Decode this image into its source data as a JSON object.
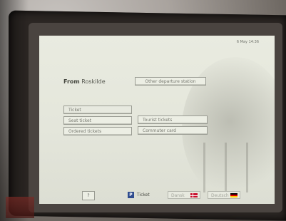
{
  "header": {
    "datetime": "6 May 14:36"
  },
  "origin": {
    "from_label": "From",
    "station": "Roskilde"
  },
  "buttons": {
    "other_departure": "Other departure station",
    "ticket_header": "Ticket",
    "seat_ticket": "Seat ticket",
    "tourist_tickets": "Tourist tickets",
    "ordered_tickets": "Ordered tickets",
    "commuter_card": "Commuter card"
  },
  "bottom": {
    "help": "?",
    "ticket_icon": "P",
    "ticket": "Ticket",
    "lang_dansk": "Dansk",
    "lang_deutsch": "Deutsch"
  }
}
